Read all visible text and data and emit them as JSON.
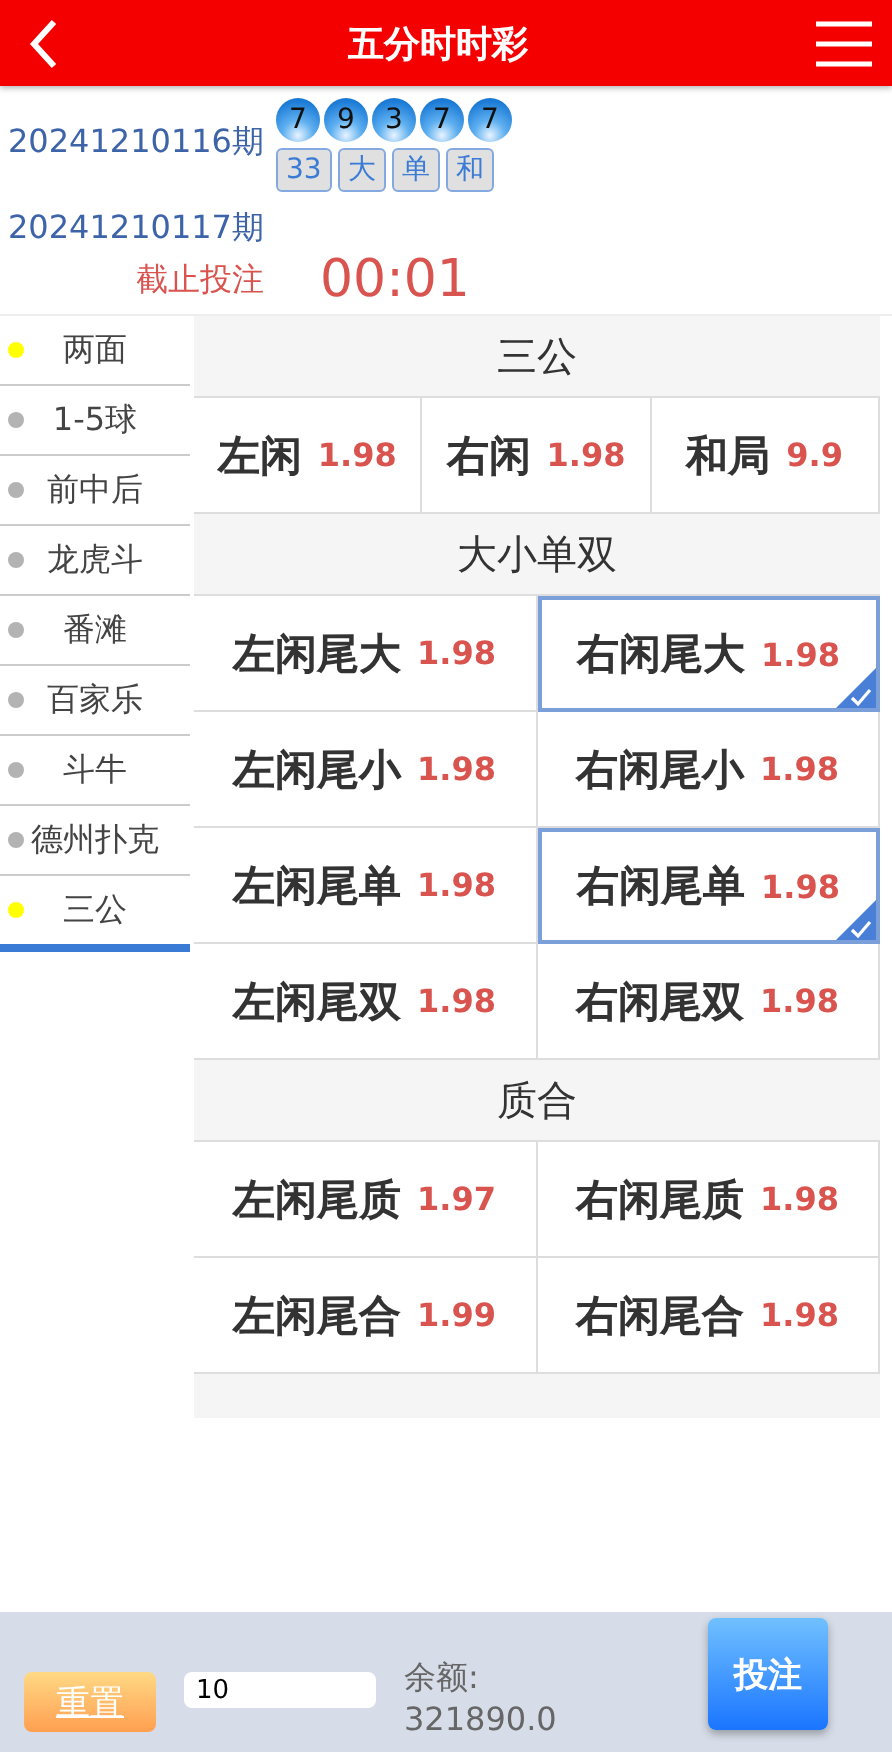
{
  "header": {
    "title": "五分时时彩"
  },
  "last_draw": {
    "issue": "20241210116期",
    "balls": [
      "7",
      "9",
      "3",
      "7",
      "7"
    ],
    "tags": [
      "33",
      "大",
      "单",
      "和"
    ]
  },
  "next_draw": {
    "issue": "20241210117期",
    "label": "截止投注",
    "countdown": "00:01"
  },
  "sidebar": {
    "items": [
      {
        "label": "两面",
        "selected": false,
        "color": "#ffff00"
      },
      {
        "label": "1-5球",
        "selected": false,
        "color": "#b3b3b3"
      },
      {
        "label": "前中后",
        "selected": false,
        "color": "#b3b3b3"
      },
      {
        "label": "龙虎斗",
        "selected": false,
        "color": "#b3b3b3"
      },
      {
        "label": "番滩",
        "selected": false,
        "color": "#b3b3b3"
      },
      {
        "label": "百家乐",
        "selected": false,
        "color": "#b3b3b3"
      },
      {
        "label": "斗牛",
        "selected": false,
        "color": "#b3b3b3"
      },
      {
        "label": "德州扑克",
        "selected": false,
        "color": "#b3b3b3"
      },
      {
        "label": "三公",
        "selected": true,
        "color": "#ffff00"
      }
    ]
  },
  "sections": [
    {
      "title": "三公",
      "bets": [
        {
          "name": "左闲",
          "odds": "1.98",
          "selected": false
        },
        {
          "name": "右闲",
          "odds": "1.98",
          "selected": false
        },
        {
          "name": "和局",
          "odds": "9.9",
          "selected": false
        }
      ]
    },
    {
      "title": "大小单双",
      "bets": [
        {
          "name": "左闲尾大",
          "odds": "1.98",
          "selected": false
        },
        {
          "name": "右闲尾大",
          "odds": "1.98",
          "selected": true
        },
        {
          "name": "左闲尾小",
          "odds": "1.98",
          "selected": false
        },
        {
          "name": "右闲尾小",
          "odds": "1.98",
          "selected": false
        },
        {
          "name": "左闲尾单",
          "odds": "1.98",
          "selected": false
        },
        {
          "name": "右闲尾单",
          "odds": "1.98",
          "selected": true
        },
        {
          "name": "左闲尾双",
          "odds": "1.98",
          "selected": false
        },
        {
          "name": "右闲尾双",
          "odds": "1.98",
          "selected": false
        }
      ]
    },
    {
      "title": "质合",
      "bets": [
        {
          "name": "左闲尾质",
          "odds": "1.97",
          "selected": false
        },
        {
          "name": "右闲尾质",
          "odds": "1.98",
          "selected": false
        },
        {
          "name": "左闲尾合",
          "odds": "1.99",
          "selected": false
        },
        {
          "name": "右闲尾合",
          "odds": "1.98",
          "selected": false
        }
      ]
    }
  ],
  "footer": {
    "reset": "重置",
    "amount": "10",
    "balance_label": "余额:",
    "balance": "321890.0",
    "submit": "投注"
  }
}
